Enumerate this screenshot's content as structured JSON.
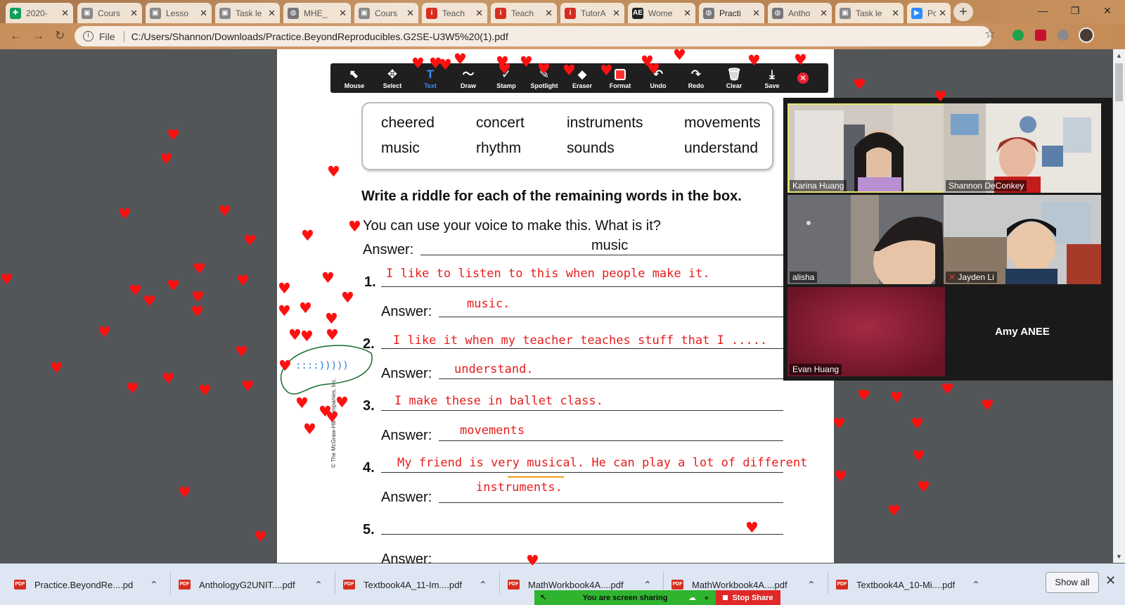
{
  "browser": {
    "tabs": [
      {
        "label": "2020-",
        "icon": "google-sheets-icon",
        "color": "#0f9d58",
        "glyph": "✚"
      },
      {
        "label": "Cours",
        "icon": "document-icon",
        "color": "#888888",
        "glyph": "▣"
      },
      {
        "label": "Lesso",
        "icon": "document-icon",
        "color": "#888888",
        "glyph": "▣"
      },
      {
        "label": "Task le",
        "icon": "document-icon",
        "color": "#888888",
        "glyph": "▣"
      },
      {
        "label": "MHE_",
        "icon": "globe-icon",
        "color": "#777777",
        "glyph": "◍"
      },
      {
        "label": "Cours",
        "icon": "document-icon",
        "color": "#888888",
        "glyph": "▣"
      },
      {
        "label": "Teach",
        "icon": "app-icon",
        "color": "#d62d20",
        "glyph": "i"
      },
      {
        "label": "Teach",
        "icon": "app-icon",
        "color": "#d62d20",
        "glyph": "i"
      },
      {
        "label": "TutorA",
        "icon": "app-icon",
        "color": "#d62d20",
        "glyph": "i"
      },
      {
        "label": "Wome",
        "icon": "ae-icon",
        "color": "#222222",
        "glyph": "AE"
      },
      {
        "label": "Practi",
        "icon": "globe-icon",
        "color": "#777777",
        "glyph": "◍"
      },
      {
        "label": "Antho",
        "icon": "globe-icon",
        "color": "#777777",
        "glyph": "◍"
      },
      {
        "label": "Task le",
        "icon": "document-icon",
        "color": "#888888",
        "glyph": "▣"
      },
      {
        "label": "Post A",
        "icon": "zoom-icon",
        "color": "#2d8cff",
        "glyph": "▶"
      }
    ],
    "active_tab_index": 10,
    "address": {
      "scheme_label": "File",
      "url": "C:/Users/Shannon/Downloads/Practice.BeyondReproducibles.G2SE-U3W5%20(1).pdf"
    }
  },
  "annotation_toolbar": {
    "tools": [
      {
        "label": "Mouse",
        "glyph": "⬉",
        "icon": "mouse-pointer-icon"
      },
      {
        "label": "Select",
        "glyph": "✥",
        "icon": "move-icon"
      },
      {
        "label": "Text",
        "glyph": "T",
        "icon": "text-icon",
        "selected": true
      },
      {
        "label": "Draw",
        "glyph": "〜",
        "icon": "draw-icon"
      },
      {
        "label": "Stamp",
        "glyph": "✓",
        "icon": "stamp-icon"
      },
      {
        "label": "Spotlight",
        "glyph": "✎",
        "icon": "spotlight-icon"
      },
      {
        "label": "Eraser",
        "glyph": "◆",
        "icon": "eraser-icon"
      },
      {
        "label": "Format",
        "glyph": "",
        "icon": "format-icon"
      },
      {
        "label": "Undo",
        "glyph": "↶",
        "icon": "undo-icon"
      },
      {
        "label": "Redo",
        "glyph": "↷",
        "icon": "redo-icon"
      },
      {
        "label": "Clear",
        "glyph": "🗑",
        "icon": "trash-icon"
      },
      {
        "label": "Save",
        "glyph": "⤓",
        "icon": "save-icon"
      }
    ],
    "format_color": "#ff3333"
  },
  "worksheet": {
    "word_box": [
      "cheered",
      "concert",
      "instruments",
      "movements",
      "music",
      "rhythm",
      "sounds",
      "understand"
    ],
    "instruction": "Write a riddle for each of the remaining words in the box.",
    "example_question": "You can use your voice to make this. What is it?",
    "answer_label": "Answer:",
    "example_answer": "music",
    "numbers": [
      "1.",
      "2.",
      "3.",
      "4.",
      "5."
    ],
    "riddles": [
      "I like to listen to this when people make it.",
      "I like it when my teacher teaches stuff that I .....",
      "I make these in ballet class.",
      "My friend is very musical.  He can play a lot of different",
      ""
    ],
    "answers": [
      "music.",
      "understand.",
      "movements",
      "instruments.",
      ""
    ],
    "copyright": "© The McGraw-Hill Companies, Inc.",
    "annotation_color": "#e81c1c"
  },
  "video_gallery": {
    "participants": [
      {
        "name": "Karina Huang",
        "active_speaker": true,
        "muted": false
      },
      {
        "name": "Shannon DeConkey",
        "active_speaker": false,
        "muted": false
      },
      {
        "name": "alisha",
        "active_speaker": false,
        "muted": false
      },
      {
        "name": "Jayden Li",
        "active_speaker": false,
        "muted": true
      },
      {
        "name": "Evan Huang",
        "active_speaker": false,
        "muted": false
      },
      {
        "name": "Amy ANEE",
        "active_speaker": false,
        "muted": false,
        "video_off": true
      }
    ]
  },
  "downloads": {
    "items": [
      "Practice.BeyondRe....pdf",
      "AnthologyG2UNIT....pdf",
      "Textbook4A_11-Im....pdf",
      "MathWorkbook4A....pdf",
      "MathWorkbook4A....pdf",
      "Textbook4A_10-Mi....pdf"
    ],
    "show_all_label": "Show all"
  },
  "screen_share": {
    "status": "You are screen sharing",
    "stop_label": "Stop Share"
  },
  "reaction": {
    "icon": "heart-icon",
    "glyph": "♥",
    "color": "#ff1010"
  }
}
